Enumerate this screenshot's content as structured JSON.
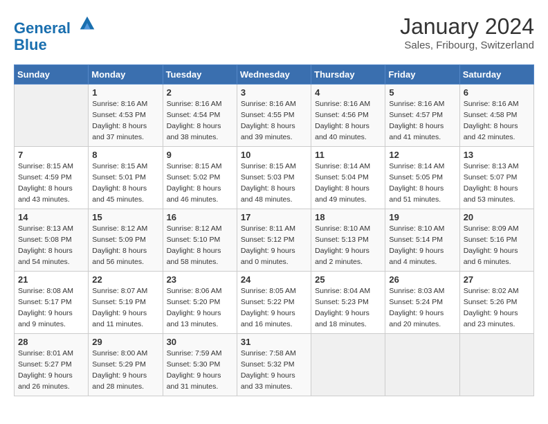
{
  "header": {
    "logo_line1": "General",
    "logo_line2": "Blue",
    "month": "January 2024",
    "location": "Sales, Fribourg, Switzerland"
  },
  "weekdays": [
    "Sunday",
    "Monday",
    "Tuesday",
    "Wednesday",
    "Thursday",
    "Friday",
    "Saturday"
  ],
  "weeks": [
    [
      {
        "day": "",
        "info": ""
      },
      {
        "day": "1",
        "info": "Sunrise: 8:16 AM\nSunset: 4:53 PM\nDaylight: 8 hours\nand 37 minutes."
      },
      {
        "day": "2",
        "info": "Sunrise: 8:16 AM\nSunset: 4:54 PM\nDaylight: 8 hours\nand 38 minutes."
      },
      {
        "day": "3",
        "info": "Sunrise: 8:16 AM\nSunset: 4:55 PM\nDaylight: 8 hours\nand 39 minutes."
      },
      {
        "day": "4",
        "info": "Sunrise: 8:16 AM\nSunset: 4:56 PM\nDaylight: 8 hours\nand 40 minutes."
      },
      {
        "day": "5",
        "info": "Sunrise: 8:16 AM\nSunset: 4:57 PM\nDaylight: 8 hours\nand 41 minutes."
      },
      {
        "day": "6",
        "info": "Sunrise: 8:16 AM\nSunset: 4:58 PM\nDaylight: 8 hours\nand 42 minutes."
      }
    ],
    [
      {
        "day": "7",
        "info": "Sunrise: 8:15 AM\nSunset: 4:59 PM\nDaylight: 8 hours\nand 43 minutes."
      },
      {
        "day": "8",
        "info": "Sunrise: 8:15 AM\nSunset: 5:01 PM\nDaylight: 8 hours\nand 45 minutes."
      },
      {
        "day": "9",
        "info": "Sunrise: 8:15 AM\nSunset: 5:02 PM\nDaylight: 8 hours\nand 46 minutes."
      },
      {
        "day": "10",
        "info": "Sunrise: 8:15 AM\nSunset: 5:03 PM\nDaylight: 8 hours\nand 48 minutes."
      },
      {
        "day": "11",
        "info": "Sunrise: 8:14 AM\nSunset: 5:04 PM\nDaylight: 8 hours\nand 49 minutes."
      },
      {
        "day": "12",
        "info": "Sunrise: 8:14 AM\nSunset: 5:05 PM\nDaylight: 8 hours\nand 51 minutes."
      },
      {
        "day": "13",
        "info": "Sunrise: 8:13 AM\nSunset: 5:07 PM\nDaylight: 8 hours\nand 53 minutes."
      }
    ],
    [
      {
        "day": "14",
        "info": "Sunrise: 8:13 AM\nSunset: 5:08 PM\nDaylight: 8 hours\nand 54 minutes."
      },
      {
        "day": "15",
        "info": "Sunrise: 8:12 AM\nSunset: 5:09 PM\nDaylight: 8 hours\nand 56 minutes."
      },
      {
        "day": "16",
        "info": "Sunrise: 8:12 AM\nSunset: 5:10 PM\nDaylight: 8 hours\nand 58 minutes."
      },
      {
        "day": "17",
        "info": "Sunrise: 8:11 AM\nSunset: 5:12 PM\nDaylight: 9 hours\nand 0 minutes."
      },
      {
        "day": "18",
        "info": "Sunrise: 8:10 AM\nSunset: 5:13 PM\nDaylight: 9 hours\nand 2 minutes."
      },
      {
        "day": "19",
        "info": "Sunrise: 8:10 AM\nSunset: 5:14 PM\nDaylight: 9 hours\nand 4 minutes."
      },
      {
        "day": "20",
        "info": "Sunrise: 8:09 AM\nSunset: 5:16 PM\nDaylight: 9 hours\nand 6 minutes."
      }
    ],
    [
      {
        "day": "21",
        "info": "Sunrise: 8:08 AM\nSunset: 5:17 PM\nDaylight: 9 hours\nand 9 minutes."
      },
      {
        "day": "22",
        "info": "Sunrise: 8:07 AM\nSunset: 5:19 PM\nDaylight: 9 hours\nand 11 minutes."
      },
      {
        "day": "23",
        "info": "Sunrise: 8:06 AM\nSunset: 5:20 PM\nDaylight: 9 hours\nand 13 minutes."
      },
      {
        "day": "24",
        "info": "Sunrise: 8:05 AM\nSunset: 5:22 PM\nDaylight: 9 hours\nand 16 minutes."
      },
      {
        "day": "25",
        "info": "Sunrise: 8:04 AM\nSunset: 5:23 PM\nDaylight: 9 hours\nand 18 minutes."
      },
      {
        "day": "26",
        "info": "Sunrise: 8:03 AM\nSunset: 5:24 PM\nDaylight: 9 hours\nand 20 minutes."
      },
      {
        "day": "27",
        "info": "Sunrise: 8:02 AM\nSunset: 5:26 PM\nDaylight: 9 hours\nand 23 minutes."
      }
    ],
    [
      {
        "day": "28",
        "info": "Sunrise: 8:01 AM\nSunset: 5:27 PM\nDaylight: 9 hours\nand 26 minutes."
      },
      {
        "day": "29",
        "info": "Sunrise: 8:00 AM\nSunset: 5:29 PM\nDaylight: 9 hours\nand 28 minutes."
      },
      {
        "day": "30",
        "info": "Sunrise: 7:59 AM\nSunset: 5:30 PM\nDaylight: 9 hours\nand 31 minutes."
      },
      {
        "day": "31",
        "info": "Sunrise: 7:58 AM\nSunset: 5:32 PM\nDaylight: 9 hours\nand 33 minutes."
      },
      {
        "day": "",
        "info": ""
      },
      {
        "day": "",
        "info": ""
      },
      {
        "day": "",
        "info": ""
      }
    ]
  ]
}
